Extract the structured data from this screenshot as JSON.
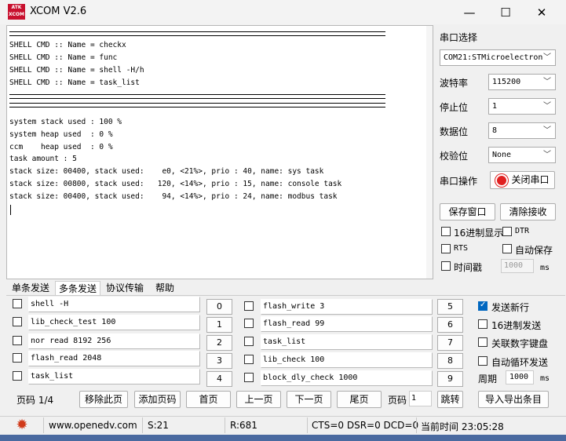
{
  "window": {
    "title": "XCOM V2.6",
    "logo_text": "ATK\nXCOM"
  },
  "terminal": {
    "lines_block1": [
      "SHELL CMD :: Name = checkx",
      "SHELL CMD :: Name = func",
      "SHELL CMD :: Name = shell -H/h",
      "SHELL CMD :: Name = task_list"
    ],
    "lines_block2": [
      "system stack used : 100 %",
      "system heap used  : 0 %",
      "ccm    heap used  : 0 %",
      "task amount : 5",
      "stack size: 00400, stack used:    e0, <21%>, prio : 40, name: sys task",
      "stack size: 00800, stack used:   120, <14%>, prio : 15, name: console task",
      "stack size: 00400, stack used:    94, <14%>, prio : 24, name: modbus task"
    ]
  },
  "serial": {
    "port_select_label": "串口选择",
    "port_value": "COM21:STMicroelectron",
    "baud_label": "波特率",
    "baud_value": "115200",
    "stopbit_label": "停止位",
    "stopbit_value": "1",
    "databit_label": "数据位",
    "databit_value": "8",
    "parity_label": "校验位",
    "parity_value": "None",
    "op_label": "串口操作",
    "close_port_label": "关闭串口",
    "save_window_label": "保存窗口",
    "clear_recv_label": "清除接收",
    "hex_display_label": "16进制显示",
    "dtr_label": "DTR",
    "rts_label": "RTS",
    "auto_save_label": "自动保存",
    "timestamp_label": "时间戳",
    "timestamp_value": "1000",
    "timestamp_unit": "ms"
  },
  "tabs": [
    "单条发送",
    "多条发送",
    "协议传输",
    "帮助"
  ],
  "multi_send": {
    "left": [
      {
        "text": "shell -H",
        "btn": "0"
      },
      {
        "text": "lib_check_test 100",
        "btn": "1"
      },
      {
        "text": "nor read 8192 256",
        "btn": "2"
      },
      {
        "text": "flash_read 2048",
        "btn": "3"
      },
      {
        "text": "task_list",
        "btn": "4"
      }
    ],
    "right": [
      {
        "text": "flash_write 3",
        "btn": "5"
      },
      {
        "text": "flash_read 99",
        "btn": "6"
      },
      {
        "text": "task_list",
        "btn": "7"
      },
      {
        "text": "lib_check 100",
        "btn": "8"
      },
      {
        "text": "block_dly_check 1000",
        "btn": "9"
      }
    ],
    "options": {
      "send_newline": "发送新行",
      "hex_send": "16进制发送",
      "link_keypad": "关联数字键盘",
      "auto_loop": "自动循环发送",
      "period_label": "周期",
      "period_value": "1000",
      "period_unit": "ms"
    }
  },
  "pager": {
    "page_label": "页码 1/4",
    "remove_page": "移除此页",
    "add_page": "添加页码",
    "first": "首页",
    "prev": "上一页",
    "next": "下一页",
    "last": "尾页",
    "goto_label": "页码",
    "goto_value": "1",
    "jump": "跳转",
    "import_export": "导入导出条目"
  },
  "status": {
    "url": "www.openedv.com",
    "sent": "S:21",
    "recv": "R:681",
    "lines": "CTS=0 DSR=0 DCD=0",
    "time": "当前时间 23:05:28"
  },
  "colors": {
    "accent": "#0067c0",
    "logo_red": "#c8102e",
    "gear_red": "#d03a1a"
  }
}
